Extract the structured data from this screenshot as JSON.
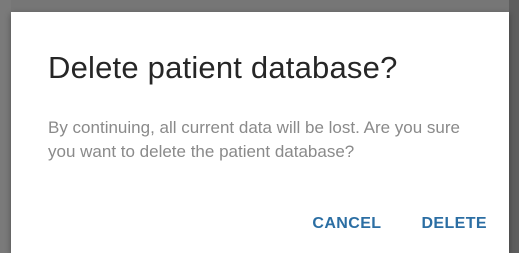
{
  "dialog": {
    "title": "Delete patient database?",
    "message": "By continuing, all current data will be lost. Are you sure you want to delete the patient database?",
    "cancel_label": "CANCEL",
    "delete_label": "DELETE"
  },
  "colors": {
    "title": "#262626",
    "message": "#8a8a8a",
    "action": "#2b6ea3",
    "dialog_background": "#ffffff",
    "backdrop": "#6b6b6b"
  }
}
